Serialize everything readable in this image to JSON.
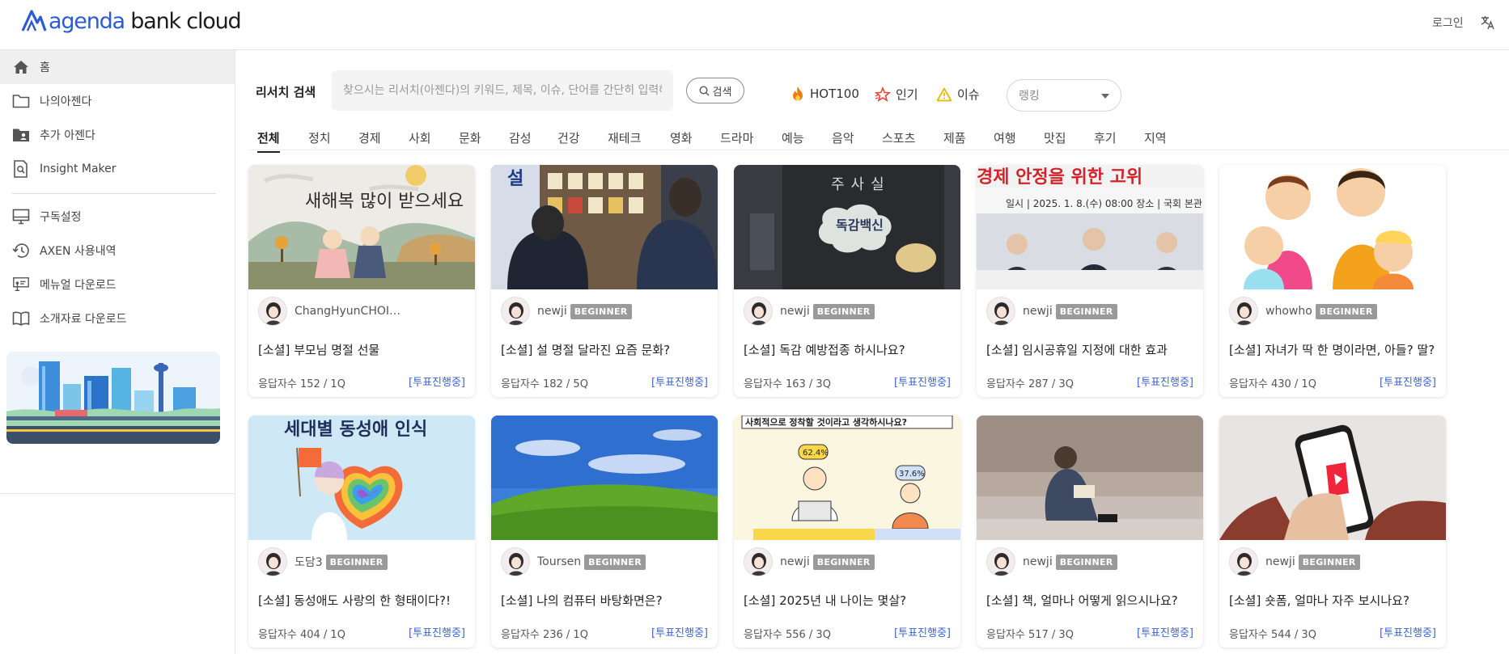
{
  "header": {
    "logo_main": "agenda",
    "logo_rest": " bank cloud",
    "login": "로그인"
  },
  "sidebar": {
    "items": [
      {
        "label": "홈",
        "icon": "home-icon"
      },
      {
        "label": "나의아젠다",
        "icon": "folder-icon"
      },
      {
        "label": "추가 아젠다",
        "icon": "folder-user-icon"
      },
      {
        "label": "Insight Maker",
        "icon": "document-search-icon"
      },
      {
        "label": "구독설정",
        "icon": "monitor-icon"
      },
      {
        "label": "AXEN 사용내역",
        "icon": "history-icon"
      },
      {
        "label": "메뉴얼 다운로드",
        "icon": "presentation-icon"
      },
      {
        "label": "소개자료 다운로드",
        "icon": "book-icon"
      }
    ]
  },
  "search": {
    "label": "리서치 검색",
    "placeholder": "찾으시는 리서치(아젠다)의 키워드, 제목, 이슈, 단어를 간단히 입력해주세요",
    "button": "검색"
  },
  "quick_links": [
    {
      "label": "HOT100",
      "icon": "fire-icon"
    },
    {
      "label": "인기",
      "icon": "star-icon"
    },
    {
      "label": "이슈",
      "icon": "warning-icon"
    }
  ],
  "ranking_select": {
    "value": "랭킹"
  },
  "tabs": [
    "전체",
    "정치",
    "경제",
    "사회",
    "문화",
    "감성",
    "건강",
    "재테크",
    "영화",
    "드라마",
    "예능",
    "음악",
    "스포츠",
    "제품",
    "여행",
    "맛집",
    "후기",
    "지역"
  ],
  "active_tab": "전체",
  "colors": {
    "accent": "#3b63d9",
    "badge": "#9a9a9a",
    "active_bg": "#efefef"
  },
  "cards": [
    {
      "author": "ChangHyunCHOI…",
      "badge": "",
      "title": "[소셜] 부모님 명절 선물",
      "stats": "응답자수 152 / 1Q",
      "status": "[투표진행중]",
      "image_text": "새해복 많이 받으세요"
    },
    {
      "author": "newji",
      "badge": "BEGINNER",
      "title": "[소셜] 설 명절 달라진 요즘 문화?",
      "stats": "응답자수 182 / 5Q",
      "status": "[투표진행중]",
      "image_text": "설"
    },
    {
      "author": "newji",
      "badge": "BEGINNER",
      "title": "[소셜] 독감 예방접종 하시나요?",
      "stats": "응답자수 163 / 3Q",
      "status": "[투표진행중]",
      "image_text": "독감백신"
    },
    {
      "author": "newji",
      "badge": "BEGINNER",
      "title": "[소셜] 임시공휴일 지정에 대한 효과",
      "stats": "응답자수 287 / 3Q",
      "status": "[투표진행중]",
      "image_text": "경제 안정을 위한 고위"
    },
    {
      "author": "whowho",
      "badge": "BEGINNER",
      "title": "[소셜] 자녀가 딱 한 명이라면, 아들? 딸?",
      "stats": "응답자수 430 / 1Q",
      "status": "[투표진행중]",
      "image_text": ""
    },
    {
      "author": "도담3",
      "badge": "BEGINNER",
      "title": "[소셜] 동성애도 사랑의 한 형태이다?!",
      "stats": "응답자수 404 / 1Q",
      "status": "[투표진행중]",
      "image_text": "세대별 동성애 인식"
    },
    {
      "author": "Toursen",
      "badge": "BEGINNER",
      "title": "[소셜] 나의 컴퓨터 바탕화면은?",
      "stats": "응답자수 236 / 1Q",
      "status": "[투표진행중]",
      "image_text": ""
    },
    {
      "author": "newji",
      "badge": "BEGINNER",
      "title": "[소셜] 2025년 내 나이는 몇살?",
      "stats": "응답자수 556 / 3Q",
      "status": "[투표진행중]",
      "image_text": "사회적으로 정착할 것이라고 생각하시나요?"
    },
    {
      "author": "newji",
      "badge": "BEGINNER",
      "title": "[소셜] 책, 얼마나 어떻게 읽으시나요?",
      "stats": "응답자수 517 / 3Q",
      "status": "[투표진행중]",
      "image_text": ""
    },
    {
      "author": "newji",
      "badge": "BEGINNER",
      "title": "[소셜] 숏폼, 얼마나 자주 보시나요?",
      "stats": "응답자수 544 / 3Q",
      "status": "[투표진행중]",
      "image_text": ""
    }
  ]
}
